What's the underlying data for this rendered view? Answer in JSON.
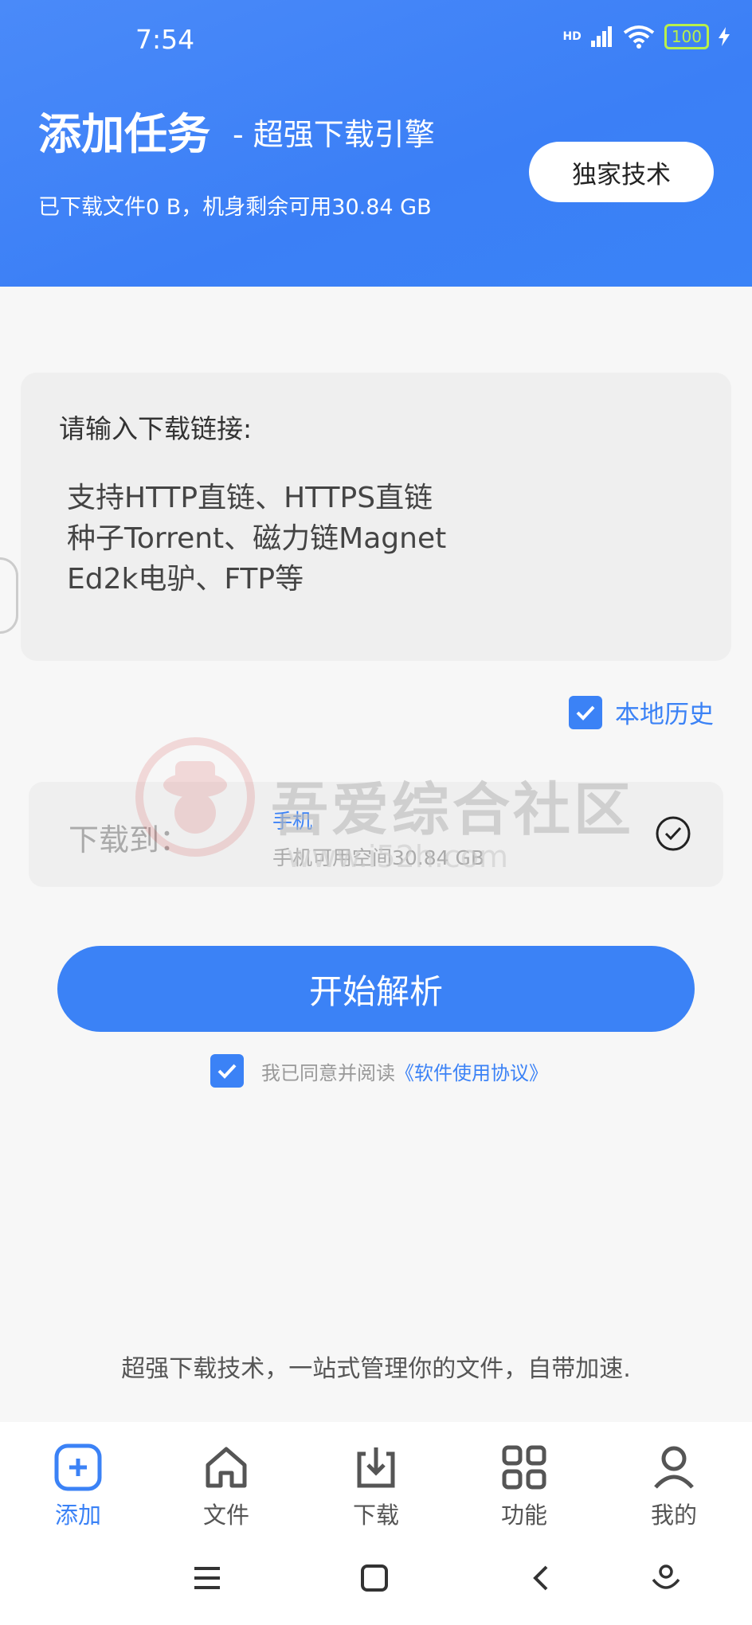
{
  "status_bar": {
    "time": "7:54",
    "network": "HD",
    "battery": "100"
  },
  "header": {
    "title": "添加任务",
    "subtitle": "- 超强下载引擎",
    "storage_info": "已下载文件0 B，机身剩余可用30.84 GB",
    "exclusive_button": "独家技术"
  },
  "url_input": {
    "label": "请输入下载链接:",
    "hint_lines": [
      "支持HTTP直链、HTTPS直链",
      "种子Torrent、磁力链Magnet",
      "Ed2k电驴、FTP等"
    ]
  },
  "history": {
    "label": "本地历史",
    "checked": true
  },
  "destination": {
    "label": "下载到：",
    "device": "手机",
    "space": "手机可用空间30.84 GB"
  },
  "start_button": "开始解析",
  "agreement": {
    "text": "我已同意并阅读",
    "link": "《软件使用协议》",
    "checked": true
  },
  "watermark": {
    "text": "吾爱综合社区",
    "url": "www.i52h.com"
  },
  "tagline": "超强下载技术，一站式管理你的文件，自带加速.",
  "tabs": [
    {
      "label": "添加",
      "icon": "add-icon",
      "active": true
    },
    {
      "label": "文件",
      "icon": "home-icon",
      "active": false
    },
    {
      "label": "下载",
      "icon": "download-icon",
      "active": false
    },
    {
      "label": "功能",
      "icon": "grid-icon",
      "active": false
    },
    {
      "label": "我的",
      "icon": "user-icon",
      "active": false
    }
  ],
  "colors": {
    "accent": "#3b82f6",
    "header": "#3b7ff6",
    "battery": "#b8f04a"
  }
}
